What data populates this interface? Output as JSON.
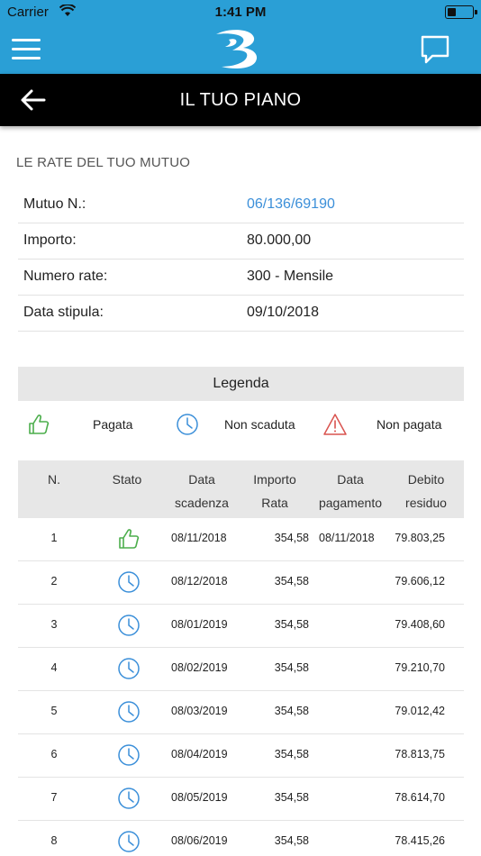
{
  "status_bar": {
    "carrier": "Carrier",
    "time": "1:41 PM",
    "battery_level": 0.35
  },
  "nav": {
    "menu_icon": "hamburger-menu-icon",
    "logo": "brand-logo",
    "chat_icon": "chat-bubble-icon",
    "accent_color": "#2a9fd6"
  },
  "titlebar": {
    "back_icon": "arrow-left-icon",
    "title": "IL TUO PIANO"
  },
  "section_title": "LE RATE DEL TUO MUTUO",
  "info": [
    {
      "label": "Mutuo N.:",
      "value": "06/136/69190",
      "link": true
    },
    {
      "label": "Importo:",
      "value": "80.000,00",
      "link": false
    },
    {
      "label": "Numero rate:",
      "value": "300 - Mensile",
      "link": false
    },
    {
      "label": "Data stipula:",
      "value": "09/10/2018",
      "link": false
    }
  ],
  "legend": {
    "title": "Legenda",
    "items": [
      {
        "icon": "thumbs-up-icon",
        "label": "Pagata",
        "color": "#4cae4c"
      },
      {
        "icon": "clock-icon",
        "label": "Non scaduta",
        "color": "#3b8fd9"
      },
      {
        "icon": "warning-triangle-icon",
        "label": "Non pagata",
        "color": "#d9534f"
      }
    ]
  },
  "table": {
    "headers": [
      {
        "line1": "N.",
        "line2": ""
      },
      {
        "line1": "Stato",
        "line2": ""
      },
      {
        "line1": "Data",
        "line2": "scadenza"
      },
      {
        "line1": "Importo",
        "line2": "Rata"
      },
      {
        "line1": "Data",
        "line2": "pagamento"
      },
      {
        "line1": "Debito",
        "line2": "residuo"
      }
    ],
    "rows": [
      {
        "n": "1",
        "stato": "thumbs-up-icon",
        "scadenza": "08/11/2018",
        "importo": "354,58",
        "pagamento": "08/11/2018",
        "debito": "79.803,25"
      },
      {
        "n": "2",
        "stato": "clock-icon",
        "scadenza": "08/12/2018",
        "importo": "354,58",
        "pagamento": "",
        "debito": "79.606,12"
      },
      {
        "n": "3",
        "stato": "clock-icon",
        "scadenza": "08/01/2019",
        "importo": "354,58",
        "pagamento": "",
        "debito": "79.408,60"
      },
      {
        "n": "4",
        "stato": "clock-icon",
        "scadenza": "08/02/2019",
        "importo": "354,58",
        "pagamento": "",
        "debito": "79.210,70"
      },
      {
        "n": "5",
        "stato": "clock-icon",
        "scadenza": "08/03/2019",
        "importo": "354,58",
        "pagamento": "",
        "debito": "79.012,42"
      },
      {
        "n": "6",
        "stato": "clock-icon",
        "scadenza": "08/04/2019",
        "importo": "354,58",
        "pagamento": "",
        "debito": "78.813,75"
      },
      {
        "n": "7",
        "stato": "clock-icon",
        "scadenza": "08/05/2019",
        "importo": "354,58",
        "pagamento": "",
        "debito": "78.614,70"
      },
      {
        "n": "8",
        "stato": "clock-icon",
        "scadenza": "08/06/2019",
        "importo": "354,58",
        "pagamento": "",
        "debito": "78.415,26"
      }
    ]
  }
}
